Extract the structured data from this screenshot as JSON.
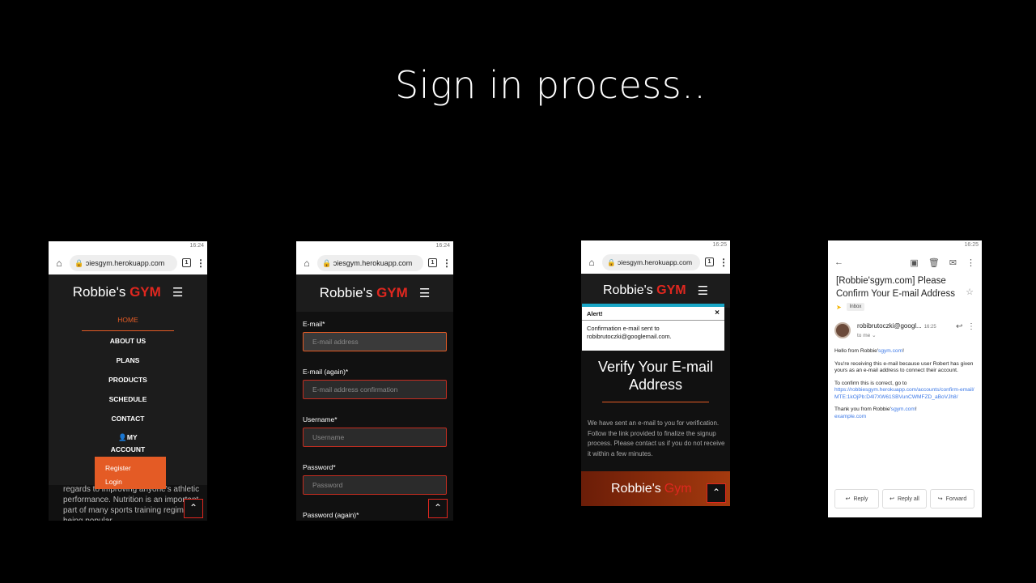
{
  "slide": {
    "title": "Sign in process.."
  },
  "colors": {
    "brand_red": "#e0271f",
    "accent_orange": "#e45b25",
    "background": "#000000"
  },
  "phone1": {
    "status_time": "16:24",
    "url": "ɔiesgym.herokuapp.com",
    "tab_count": "1",
    "brand_prefix": "Robbie's",
    "brand_suffix": "GYM",
    "nav": [
      "HOME",
      "ABOUT US",
      "PLANS",
      "PRODUCTS",
      "SCHEDULE",
      "CONTACT"
    ],
    "account_label_1": "MY",
    "account_label_2": "ACCOUNT",
    "dropdown": [
      "Register",
      "Login"
    ],
    "bg_text": "regards to improving anyone's athletic performance. Nutrition is an important part of many sports training regimens, being popular"
  },
  "phone2": {
    "status_time": "16:24",
    "url": "ɔiesgym.herokuapp.com",
    "tab_count": "1",
    "brand_prefix": "Robbie's",
    "brand_suffix": "GYM",
    "fields": [
      {
        "label": "E-mail*",
        "placeholder": "E-mail address"
      },
      {
        "label": "E-mail (again)*",
        "placeholder": "E-mail address confirmation"
      },
      {
        "label": "Username*",
        "placeholder": "Username"
      },
      {
        "label": "Password*",
        "placeholder": "Password"
      },
      {
        "label": "Password (again)*",
        "placeholder": ""
      }
    ]
  },
  "phone3": {
    "status_time": "16:25",
    "url": "ɔiesgym.herokuapp.com",
    "tab_count": "1",
    "brand_prefix": "Robbie's",
    "brand_suffix": "GYM",
    "alert_title": "Alert!",
    "alert_close": "×",
    "alert_message_1": "Confirmation e-mail sent to",
    "alert_message_2": "robibrutoczki@googlemail.com.",
    "verify_title": "Verify Your E-mail Address",
    "verify_text": "We have sent an e-mail to you for verification. Follow the link provided to finalize the signup process. Please contact us if you do not receive it within a few minutes.",
    "footer_brand_prefix": "Robbie's",
    "footer_brand_suffix": "Gym"
  },
  "phone4": {
    "status_time": "16:25",
    "subject": "[Robbie'sgym.com] Please Confirm Your E-mail Address",
    "tag": "Inbox",
    "sender": "robibrutoczki@googl...",
    "time": "16:25",
    "to": "to me",
    "greeting_prefix": "Hello from Robbie'",
    "greeting_link": "sgym.com",
    "greeting_suffix": "!",
    "para1": "You're receiving this e-mail because user Robert has given yours as an e-mail address to connect their account.",
    "para2": "To confirm this is correct, go to",
    "confirm_link": "https://robbiesgym.herokuapp.com/accounts/confirm-email/MTE:1kOjPb:D4l7XW61SBVunCWMFZD_aBoVJh8/",
    "thanks_prefix": "Thank you from Robbie'",
    "thanks_link": "sgym.com",
    "thanks_suffix": "!",
    "footer_link": "example.com",
    "buttons": [
      "Reply",
      "Reply all",
      "Forward"
    ]
  }
}
